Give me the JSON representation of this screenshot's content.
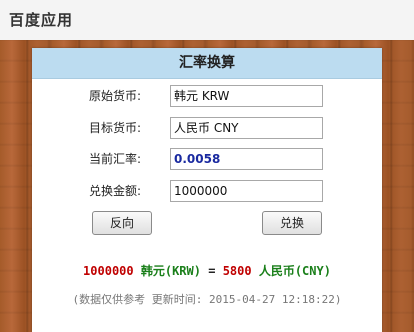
{
  "app": {
    "title": "百度应用"
  },
  "converter": {
    "heading": "汇率换算",
    "source_label": "原始货币:",
    "source_value": "韩元 KRW",
    "target_label": "目标货币:",
    "target_value": "人民币 CNY",
    "rate_label": "当前汇率:",
    "rate_value": "0.0058",
    "amount_label": "兑换金额:",
    "amount_value": "1000000",
    "reverse_button": "反向",
    "convert_button": "兑换"
  },
  "result": {
    "amount": "1000000",
    "from_currency": "韩元(KRW)",
    "equals": "=",
    "converted": "5800",
    "to_currency": "人民币(CNY)"
  },
  "disclaimer": "(数据仅供参考 更新时间: 2015-04-27 12:18:22)",
  "colors": {
    "header_bar": "#bcdcf0",
    "result_amount": "#c00000",
    "result_currency": "#1a7f1a",
    "rate_text": "#1a2aa0"
  }
}
